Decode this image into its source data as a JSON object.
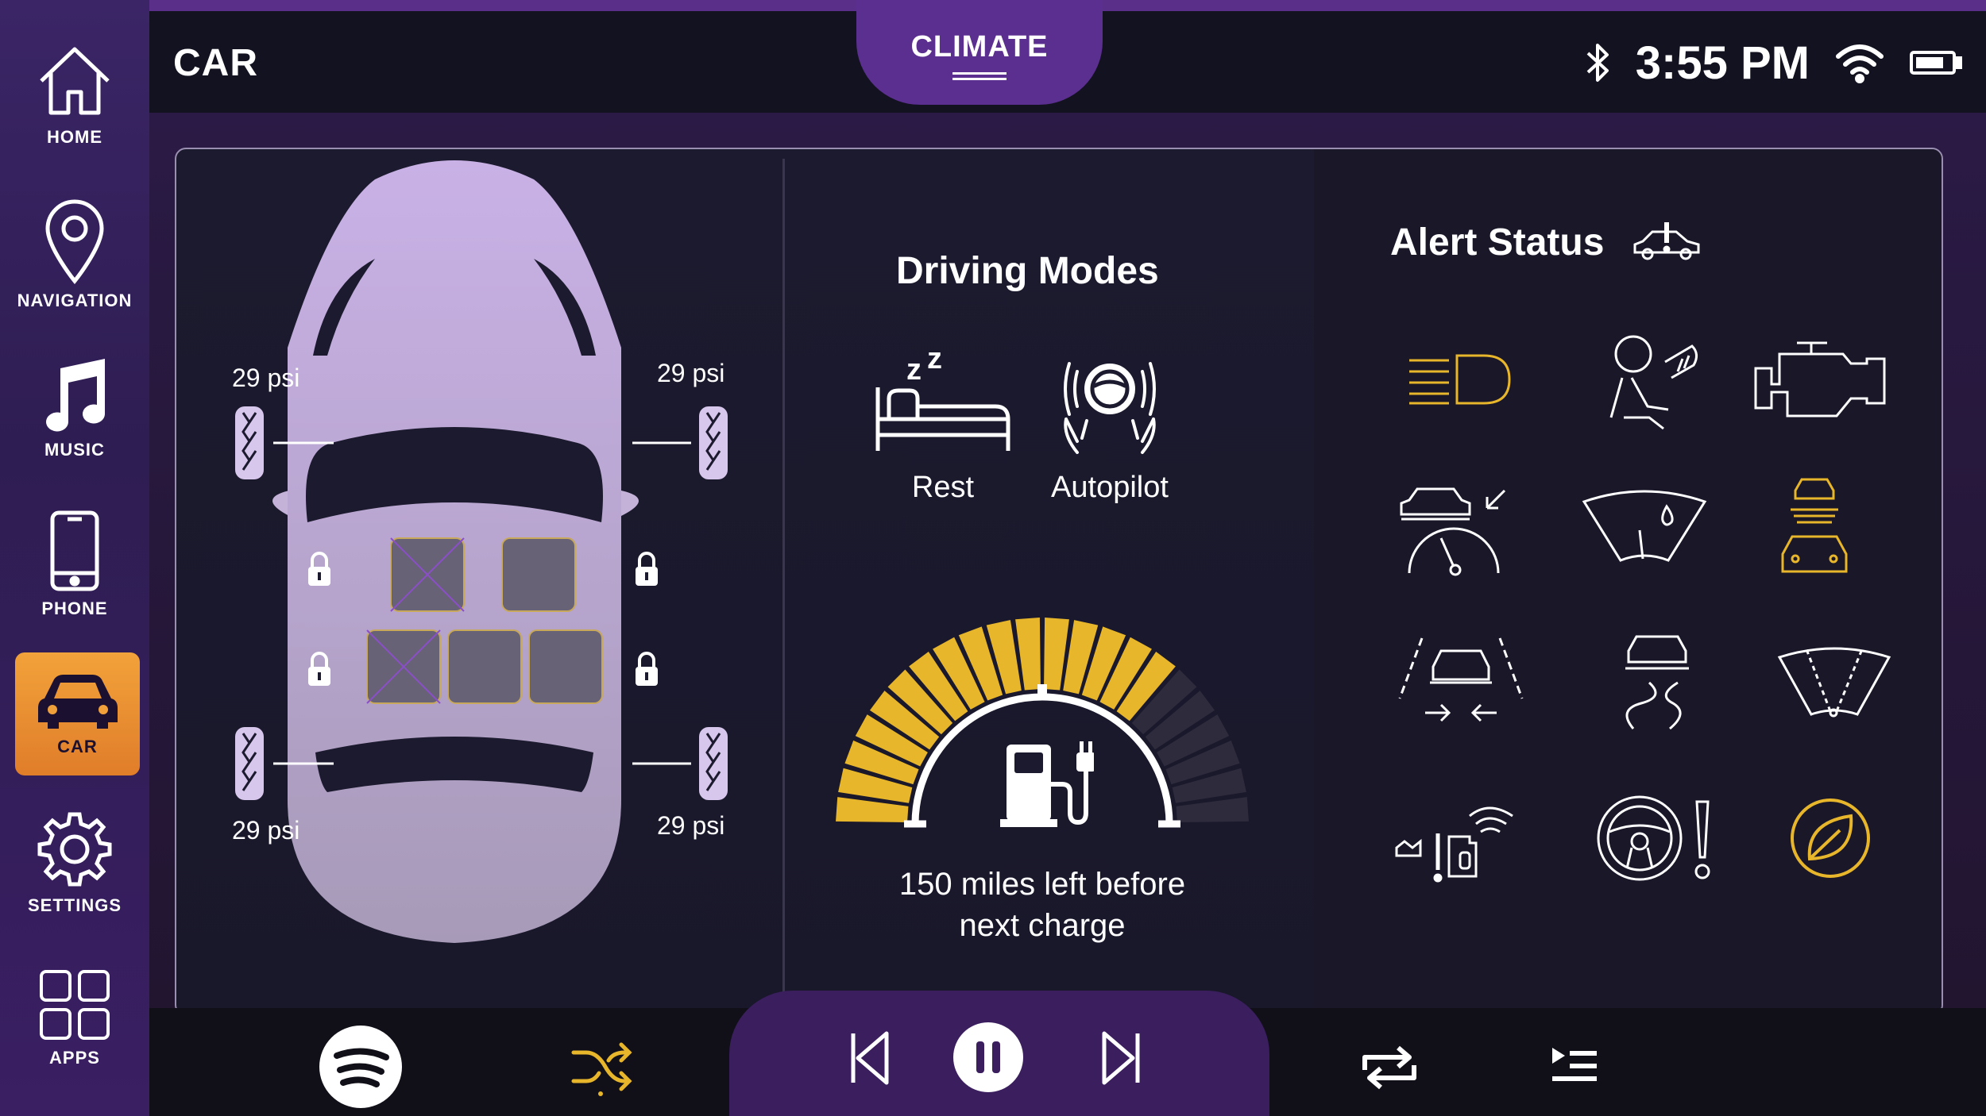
{
  "header": {
    "title": "CAR",
    "climate_tab": "CLIMATE",
    "time": "3:55 PM"
  },
  "status_icons": [
    "bluetooth-icon",
    "wifi-icon",
    "battery-icon"
  ],
  "sidebar": {
    "items": [
      {
        "label": "HOME",
        "icon": "home-icon"
      },
      {
        "label": "NAVIGATION",
        "icon": "map-pin-icon"
      },
      {
        "label": "MUSIC",
        "icon": "music-note-icon"
      },
      {
        "label": "PHONE",
        "icon": "phone-icon"
      },
      {
        "label": "CAR",
        "icon": "car-icon",
        "active": true
      },
      {
        "label": "SETTINGS",
        "icon": "gear-icon"
      },
      {
        "label": "APPS",
        "icon": "apps-grid-icon"
      }
    ]
  },
  "car_status": {
    "tires": {
      "front_left": "29 psi",
      "front_right": "29 psi",
      "rear_left": "29 psi",
      "rear_right": "29 psi"
    },
    "door_locks": [
      "locked",
      "locked",
      "locked",
      "locked"
    ]
  },
  "driving_modes": {
    "title": "Driving Modes",
    "modes": [
      {
        "label": "Rest",
        "icon": "bed-sleep-icon"
      },
      {
        "label": "Autopilot",
        "icon": "autopilot-wheel-icon"
      }
    ]
  },
  "range": {
    "text_line1": "150 miles left before",
    "text_line2": "next charge",
    "charge_segments_filled": 16,
    "charge_segments_total": 22
  },
  "alerts": {
    "title": "Alert Status",
    "title_icon": "car-alert-icon",
    "icons": [
      "headlight-icon",
      "airbag-icon",
      "engine-icon",
      "speed-assist-icon",
      "washer-fluid-icon",
      "forward-collision-icon",
      "lane-assist-icon",
      "slippery-road-icon",
      "wiper-icon",
      "tire-pressure-sensor-icon",
      "steering-warning-icon",
      "eco-mode-icon"
    ],
    "active_color": "#e8b62a",
    "inactive_color": "#ffffff"
  },
  "player": {
    "app_icon": "spotify-icon",
    "controls": [
      "shuffle",
      "previous",
      "pause",
      "next",
      "repeat",
      "queue"
    ]
  },
  "colors": {
    "accent": "#e8b62a",
    "sidebar_active": "#f0a03a",
    "purple": "#5b2f8f"
  }
}
